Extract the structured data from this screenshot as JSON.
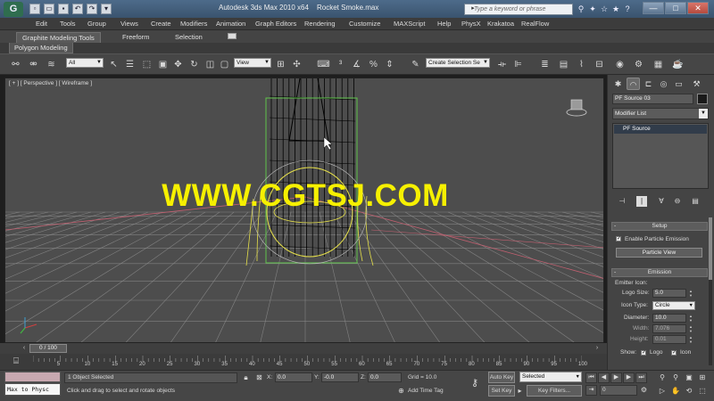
{
  "titlebar": {
    "app_title": "Autodesk 3ds Max  2010 x64",
    "file_name": "Rocket Smoke.max",
    "search_placeholder": "Type a keyword or phrase",
    "window_buttons": [
      "—",
      "□",
      "✕"
    ]
  },
  "menubar": {
    "items": [
      "Edit",
      "Tools",
      "Group",
      "Views",
      "Create",
      "Modifiers",
      "Animation",
      "Graph Editors",
      "Rendering",
      "Customize",
      "MAXScript",
      "Help",
      "PhysX",
      "Krakatoa",
      "RealFlow"
    ]
  },
  "ribbon": {
    "tabs": [
      "Graphite Modeling Tools",
      "Freeform",
      "Selection"
    ],
    "panel_tab": "Polygon Modeling"
  },
  "toolbar": {
    "selection_filter": "All",
    "reference_coord": "View",
    "named_selection": "Create Selection Se"
  },
  "viewport": {
    "label": "[ + ] [ Perspective ] [ Wireframe ]",
    "watermark": "WWW.CGTSJ.COM",
    "wire_color": "#000000",
    "selection_box_color": "#5ec24a",
    "emitter_color": "#e6e04a",
    "grid_color": "#8f8f8f",
    "axis_line_color": "#c06070"
  },
  "command_panel": {
    "object_name": "PF Source 03",
    "modifier_list": "Modifier List",
    "stack_items": [
      "PF Source"
    ],
    "setup": {
      "title": "Setup",
      "enable_emission_label": "Enable Particle Emission",
      "enable_emission_checked": true,
      "particle_view_button": "Particle View"
    },
    "emission": {
      "title": "Emission",
      "emitter_icon_label": "Emitter Icon:",
      "logo_size_label": "Logo Size:",
      "logo_size": "5.0",
      "icon_type_label": "Icon Type:",
      "icon_type": "Circle",
      "diameter_label": "Diameter:",
      "diameter": "10.0",
      "width_label": "Width:",
      "width": "7.076",
      "height_label": "Height:",
      "height": "0.01",
      "show_label": "Show:",
      "show_logo_label": "Logo",
      "show_logo_checked": true,
      "show_icon_label": "Icon",
      "show_icon_checked": true
    }
  },
  "timeline": {
    "slider_label": "0 / 100",
    "ticks": [
      "5",
      "10",
      "15",
      "20",
      "25",
      "30",
      "35",
      "40",
      "45",
      "50",
      "55",
      "60",
      "65",
      "70",
      "75",
      "80",
      "85",
      "90",
      "95",
      "100"
    ]
  },
  "statusbar": {
    "maxscript_text": "Max to Physc",
    "selection_status": "1 Object Selected",
    "prompt": "Click and drag to select and rotate objects",
    "x_label": "X:",
    "x_value": "0.0",
    "y_label": "Y:",
    "y_value": "-0.0",
    "z_label": "Z:",
    "z_value": "0.0",
    "grid_label": "Grid = 10.0",
    "add_time_tag": "Add Time Tag",
    "auto_key": "Auto Key",
    "set_key": "Set Key",
    "key_mode": "Selected",
    "key_filters": "Key Filters...",
    "frame": "0"
  }
}
